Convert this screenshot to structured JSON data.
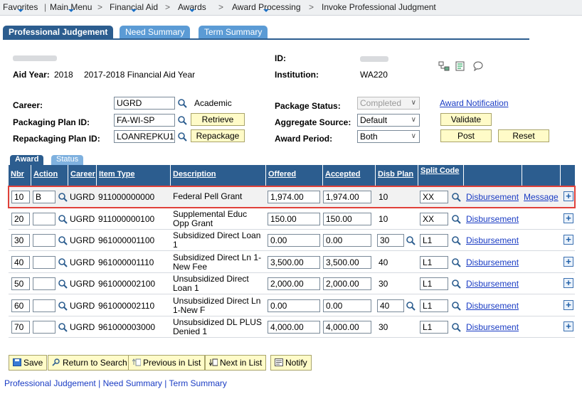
{
  "breadcrumb": {
    "items": [
      "Favorites",
      "Main Menu",
      "Financial Aid",
      "Awards",
      "Award Processing",
      "Invoke Professional Judgment"
    ],
    "separator": ">"
  },
  "page_tabs": [
    "Professional Judgement",
    "Need Summary",
    "Term Summary"
  ],
  "header": {
    "aid_year_label": "Aid Year:",
    "aid_year": "2018",
    "aid_year_desc": "2017-2018 Financial Aid Year",
    "id_label": "ID:",
    "institution_label": "Institution:",
    "institution": "WA220"
  },
  "form": {
    "career_label": "Career:",
    "career_value": "UGRD",
    "career_desc": "Academic",
    "packaging_plan_label": "Packaging Plan ID:",
    "packaging_plan_value": "FA-WI-SP",
    "retrieve_label": "Retrieve",
    "repackaging_plan_label": "Repackaging Plan ID:",
    "repackaging_plan_value": "LOANREPKU1",
    "repackage_label": "Repackage",
    "package_status_label": "Package Status:",
    "package_status_value": "Completed",
    "aggregate_source_label": "Aggregate Source:",
    "aggregate_source_value": "Default",
    "award_period_label": "Award Period:",
    "award_period_value": "Both",
    "award_notification_link": "Award Notification",
    "validate_label": "Validate",
    "post_label": "Post",
    "reset_label": "Reset"
  },
  "grid": {
    "tabs": [
      "Award",
      "Status"
    ],
    "columns": [
      "Nbr",
      "Action",
      "Career",
      "Item Type",
      "Description",
      "Offered",
      "Accepted",
      "Disb Plan",
      "Split Code"
    ],
    "rows": [
      {
        "nbr": "10",
        "action": "B",
        "career": "UGRD",
        "item_type": "911000000000",
        "desc": "Federal Pell Grant",
        "offered": "1,974.00",
        "accepted": "1,974.00",
        "disb_plan": "10",
        "disb_input": false,
        "split": "XX",
        "disb_link": "Disbursement",
        "msg_link": "Message"
      },
      {
        "nbr": "20",
        "action": "",
        "career": "UGRD",
        "item_type": "911000000100",
        "desc": "Supplemental Educ Opp Grant",
        "offered": "150.00",
        "accepted": "150.00",
        "disb_plan": "10",
        "disb_input": false,
        "split": "XX",
        "disb_link": "Disbursement",
        "msg_link": ""
      },
      {
        "nbr": "30",
        "action": "",
        "career": "UGRD",
        "item_type": "961000001100",
        "desc": "Subsidized Direct Loan 1",
        "offered": "0.00",
        "accepted": "0.00",
        "disb_plan": "30",
        "disb_input": true,
        "split": "L1",
        "disb_link": "Disbursement",
        "msg_link": ""
      },
      {
        "nbr": "40",
        "action": "",
        "career": "UGRD",
        "item_type": "961000001110",
        "desc": "Subsidized Direct Ln 1-New Fee",
        "offered": "3,500.00",
        "accepted": "3,500.00",
        "disb_plan": "40",
        "disb_input": false,
        "split": "L1",
        "disb_link": "Disbursement",
        "msg_link": ""
      },
      {
        "nbr": "50",
        "action": "",
        "career": "UGRD",
        "item_type": "961000002100",
        "desc": "Unsubsidized Direct Loan 1",
        "offered": "2,000.00",
        "accepted": "2,000.00",
        "disb_plan": "30",
        "disb_input": false,
        "split": "L1",
        "disb_link": "Disbursement",
        "msg_link": ""
      },
      {
        "nbr": "60",
        "action": "",
        "career": "UGRD",
        "item_type": "961000002110",
        "desc": "Unsubsidized Direct Ln 1-New F",
        "offered": "0.00",
        "accepted": "0.00",
        "disb_plan": "40",
        "disb_input": true,
        "split": "L1",
        "disb_link": "Disbursement",
        "msg_link": ""
      },
      {
        "nbr": "70",
        "action": "",
        "career": "UGRD",
        "item_type": "961000003000",
        "desc": "Unsubsidized DL PLUS Denied 1",
        "offered": "4,000.00",
        "accepted": "4,000.00",
        "disb_plan": "30",
        "disb_input": false,
        "split": "L1",
        "disb_link": "Disbursement",
        "msg_link": ""
      }
    ]
  },
  "toolbar": {
    "save": "Save",
    "return": "Return to Search",
    "previous": "Previous in List",
    "next": "Next in List",
    "notify": "Notify"
  },
  "footer": {
    "current": "Professional Judgement",
    "sep": "|",
    "link1": "Need Summary",
    "link2": "Term Summary"
  },
  "colors": {
    "tab_active": "#2c5d8f",
    "tab_inactive": "#5b9bd5",
    "button_bg": "#fffbc8",
    "highlight_border": "#e0413a",
    "link": "#1a3cc4"
  }
}
